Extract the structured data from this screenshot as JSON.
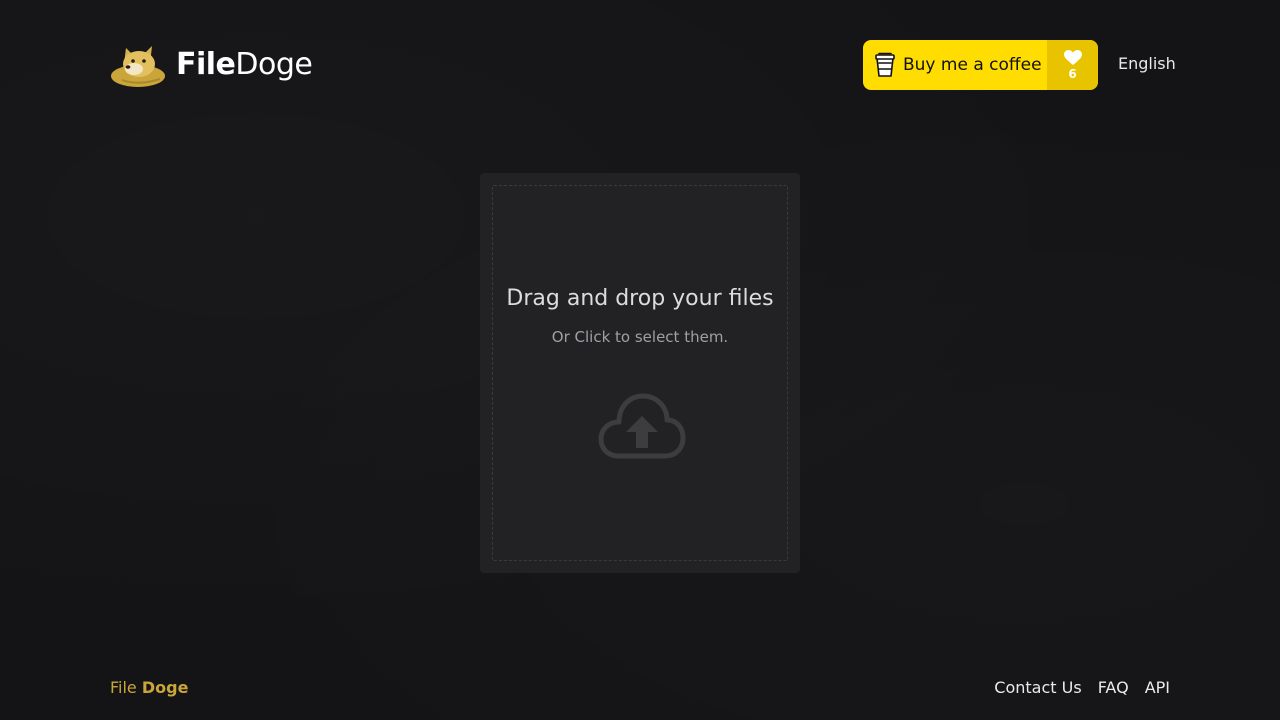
{
  "header": {
    "logo": {
      "text_bold": "File",
      "text_light": "Doge",
      "icon": "doge-icon"
    },
    "coffee_button": {
      "label": "Buy me a coffee",
      "count": "6",
      "icon": "coffee-cup-icon",
      "count_icon": "heart-icon",
      "color": "#ffdd00"
    },
    "language": "English"
  },
  "dropzone": {
    "title": "Drag and drop your files",
    "subtitle": "Or Click to select them.",
    "icon": "cloud-upload-icon"
  },
  "footer": {
    "brand_light": "File",
    "brand_bold": "Doge",
    "brand_color": "#c9a53a",
    "links": [
      "Contact Us",
      "FAQ",
      "API"
    ]
  }
}
